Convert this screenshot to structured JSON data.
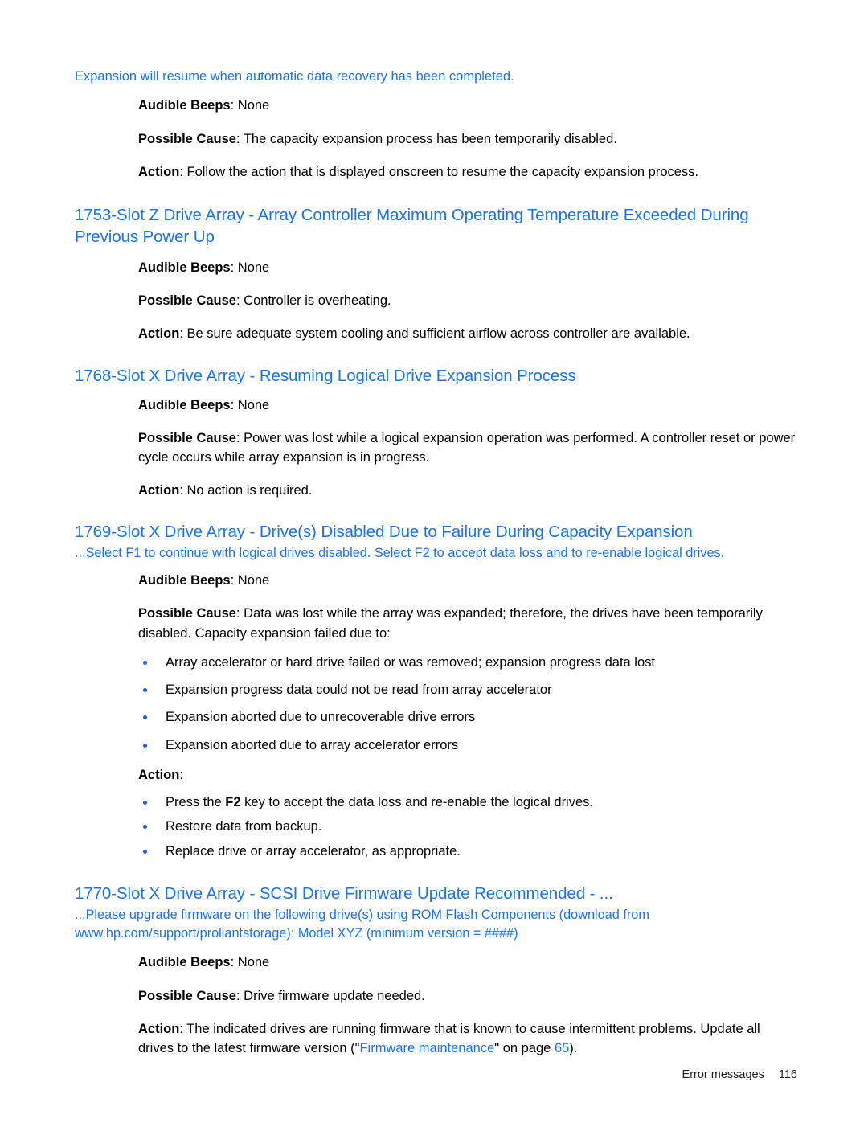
{
  "page": {
    "continuation_line": "Expansion will resume when automatic data recovery has been completed.",
    "labels": {
      "audible_beeps": "Audible Beeps",
      "possible_cause": "Possible Cause",
      "action": "Action"
    }
  },
  "intro_section": {
    "audible_beeps_label": "Audible Beeps",
    "audible_beeps_value": ": None",
    "possible_cause_label": "Possible Cause",
    "possible_cause_value": ": The capacity expansion process has been temporarily disabled.",
    "action_label": "Action",
    "action_value": ": Follow the action that is displayed onscreen to resume the capacity expansion process."
  },
  "section_1753": {
    "heading": "1753-Slot Z Drive Array - Array Controller Maximum Operating Temperature Exceeded During Previous Power Up",
    "audible_beeps_label": "Audible Beeps",
    "audible_beeps_value": ": None",
    "possible_cause_label": "Possible Cause",
    "possible_cause_value": ": Controller is overheating.",
    "action_label": "Action",
    "action_value": ": Be sure adequate system cooling and sufficient airflow across controller are available."
  },
  "section_1768": {
    "heading": "1768-Slot X Drive Array - Resuming Logical Drive Expansion Process",
    "audible_beeps_label": "Audible Beeps",
    "audible_beeps_value": ": None",
    "possible_cause_label": "Possible Cause",
    "possible_cause_value": ": Power was lost while a logical expansion operation was performed. A controller reset or power cycle occurs while array expansion is in progress.",
    "action_label": "Action",
    "action_value": ": No action is required."
  },
  "section_1769": {
    "heading": "1769-Slot X Drive Array - Drive(s) Disabled Due to Failure During Capacity Expansion",
    "subheading": "...Select F1 to continue with logical drives disabled. Select F2 to accept data loss and to re-enable logical drives.",
    "audible_beeps_label": "Audible Beeps",
    "audible_beeps_value": ": None",
    "possible_cause_label": "Possible Cause",
    "possible_cause_value": ": Data was lost while the array was expanded; therefore, the drives have been temporarily disabled. Capacity expansion failed due to:",
    "cause_bullets": [
      "Array accelerator or hard drive failed or was removed; expansion progress data lost",
      "Expansion progress data could not be read from array accelerator",
      "Expansion aborted due to unrecoverable drive errors",
      "Expansion aborted due to array accelerator errors"
    ],
    "action_label": "Action",
    "action_value": ":",
    "action_bullet_1_pre": "Press the ",
    "action_bullet_1_key": "F2",
    "action_bullet_1_post": " key to accept the data loss and re-enable the logical drives.",
    "action_bullet_2": "Restore data from backup.",
    "action_bullet_3": "Replace drive or array accelerator, as appropriate."
  },
  "section_1770": {
    "heading": "1770-Slot X Drive Array - SCSI Drive Firmware Update Recommended - ...",
    "subheading": "...Please upgrade firmware on the following drive(s) using ROM Flash Components (download from www.hp.com/support/proliantstorage): Model XYZ (minimum version = ####)",
    "audible_beeps_label": "Audible Beeps",
    "audible_beeps_value": ": None",
    "possible_cause_label": "Possible Cause",
    "possible_cause_value": ": Drive firmware update needed.",
    "action_label": "Action",
    "action_pre": ": The indicated drives are running firmware that is known to cause intermittent problems. Update all drives to the latest firmware version (\"",
    "action_link": "Firmware maintenance",
    "action_mid": "\" on page ",
    "action_page": "65",
    "action_post": ")."
  },
  "footer": {
    "label": "Error messages",
    "page_number": "116"
  },
  "colors": {
    "heading_blue": "#1a74e8",
    "bullet_blue": "#1663e0",
    "body_black": "#000000"
  }
}
